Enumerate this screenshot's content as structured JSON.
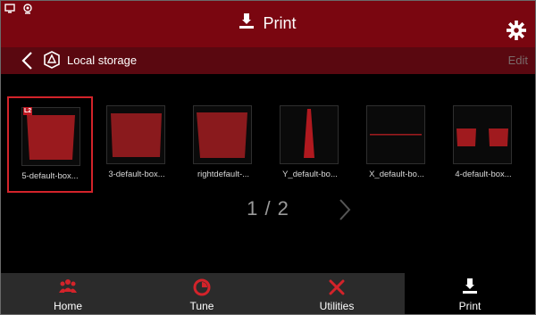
{
  "header": {
    "title": "Print",
    "icon": "print-icon",
    "settings_icon": "gear-icon"
  },
  "breadcrumb": {
    "back_icon": "chevron-left-icon",
    "storage_icon": "storage-icon",
    "label": "Local storage",
    "edit_label": "Edit"
  },
  "files": [
    {
      "name": "5-default-box...",
      "shape": "box-tapered",
      "badge": "L2",
      "selected": true
    },
    {
      "name": "3-default-box...",
      "shape": "box",
      "selected": false
    },
    {
      "name": "rightdefault-...",
      "shape": "box-tapered",
      "selected": false
    },
    {
      "name": "Y_default-bo...",
      "shape": "spike",
      "selected": false
    },
    {
      "name": "X_default-bo...",
      "shape": "line",
      "selected": false
    },
    {
      "name": "4-default-box...",
      "shape": "two-blocks",
      "selected": false
    }
  ],
  "pagination": {
    "text": "1 / 2",
    "next_icon": "chevron-right-icon"
  },
  "nav": [
    {
      "label": "Home",
      "icon": "people-icon",
      "active": false
    },
    {
      "label": "Tune",
      "icon": "pie-icon",
      "active": false
    },
    {
      "label": "Utilities",
      "icon": "tools-icon",
      "active": false
    },
    {
      "label": "Print",
      "icon": "print-icon",
      "active": true
    }
  ],
  "colors": {
    "accent": "#c01822",
    "topbar": "#7a0610",
    "crumbbar": "#5a0810",
    "navbar": "#2b2b2b"
  }
}
